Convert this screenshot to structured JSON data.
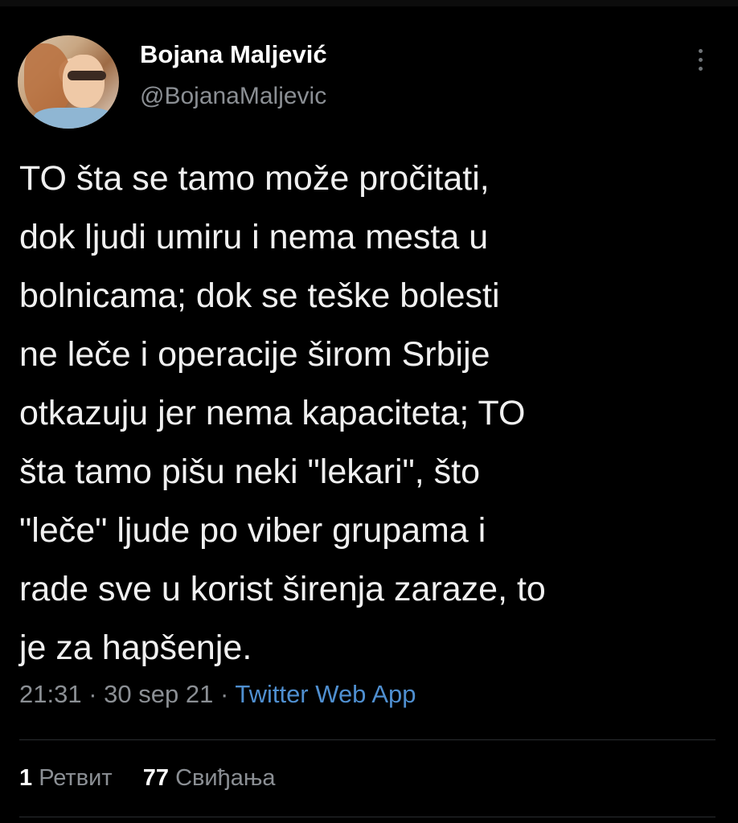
{
  "author": {
    "display_name": "Bojana Maljević",
    "handle": "@BojanaMaljevic",
    "avatar_icon": "profile-photo"
  },
  "tweet": {
    "text": "TO šta se tamo može pročitati,\ndok ljudi umiru i nema mesta u\nbolnicama; dok se teške bolesti\nne leče i operacije širom Srbije\notkazuju jer nema kapaciteta; TO\nšta tamo pišu neki \"lekari\", što\n\"leče\" ljude po viber grupama i\nrade sve u korist širenja zaraze, to\nje za hapšenje.",
    "time": "21:31",
    "separator": "·",
    "date": "30 sep 21",
    "source": "Twitter Web App"
  },
  "stats": {
    "retweet_count": "1",
    "retweet_label": "Ретвит",
    "like_count": "77",
    "like_label": "Свиђања"
  },
  "menu": {
    "more_icon": "more-vertical-icon"
  },
  "colors": {
    "background": "#000000",
    "text": "#f0f0f0",
    "secondary": "#8b8f94",
    "link": "#4f8fd0"
  }
}
